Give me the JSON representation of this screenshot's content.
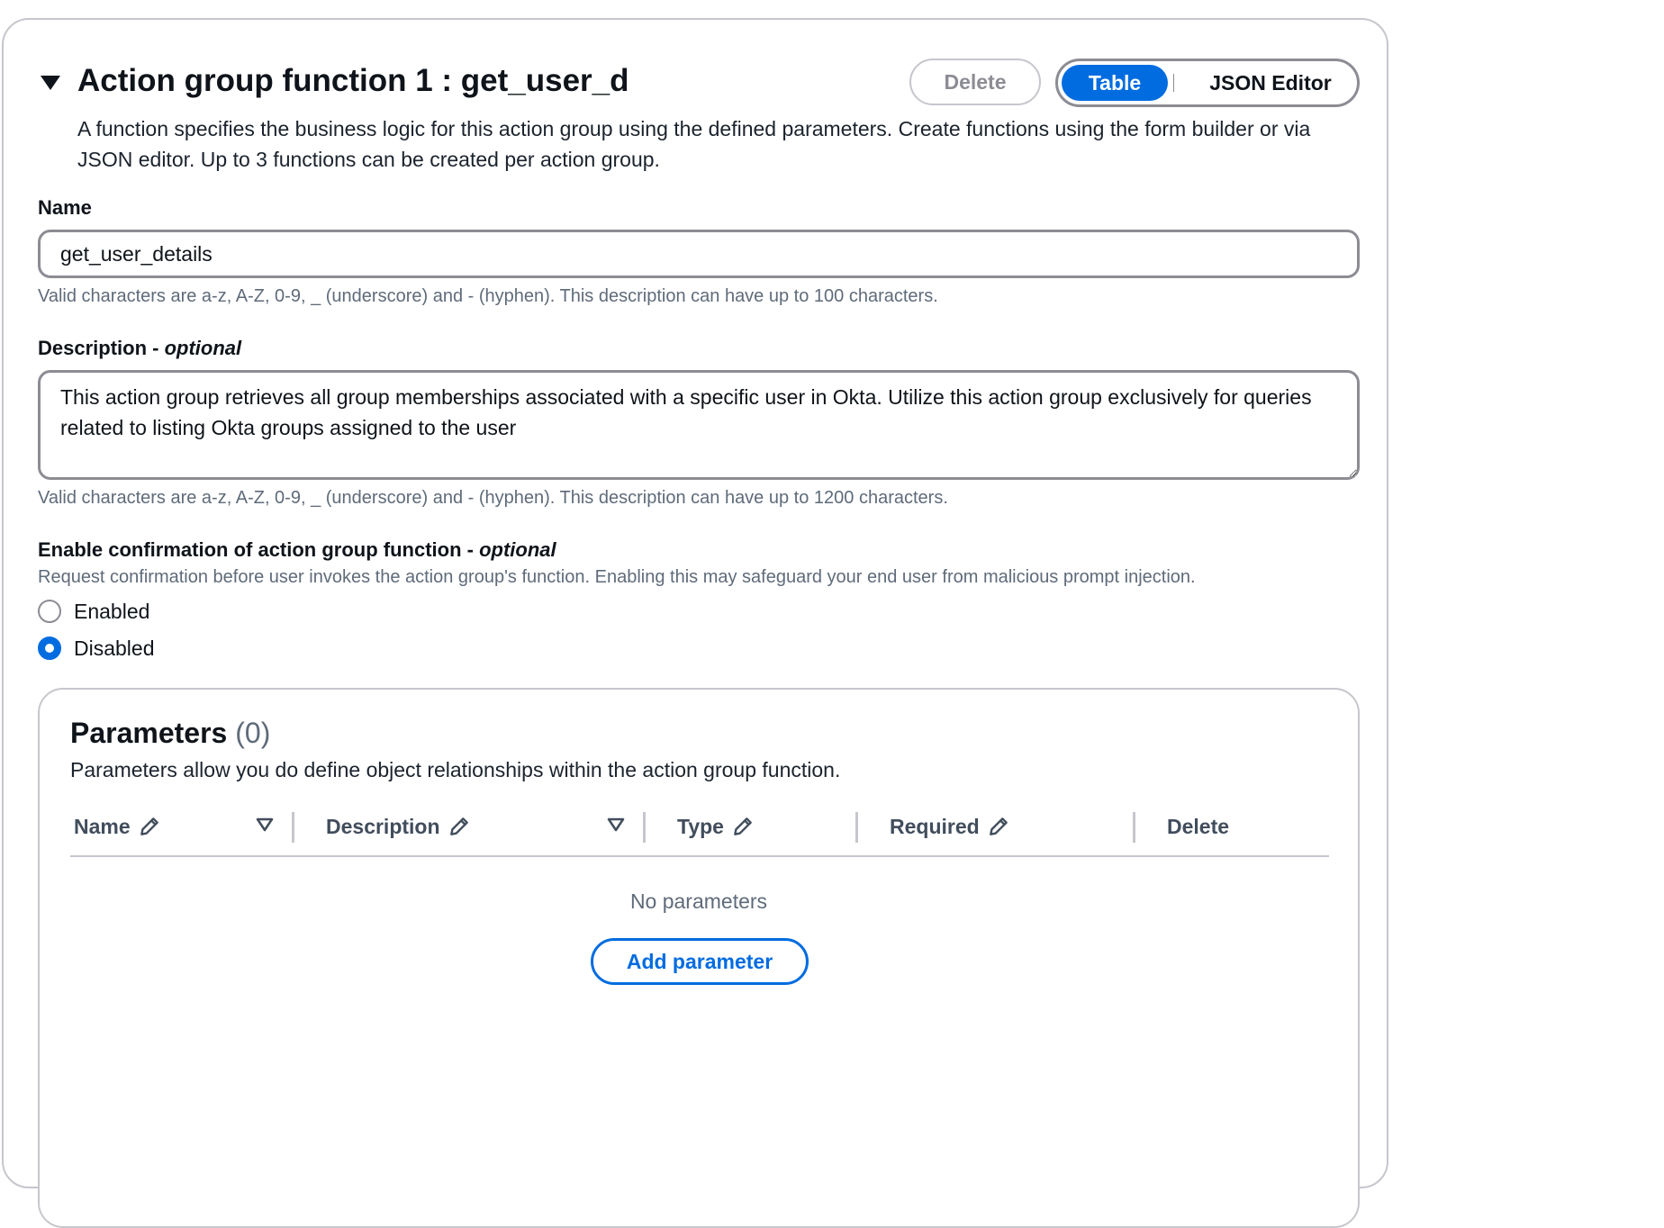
{
  "header": {
    "title": "Action group function 1 : get_user_d",
    "delete_label": "Delete",
    "view_toggle": {
      "table_label": "Table",
      "json_label": "JSON Editor",
      "selected": "Table"
    },
    "description": "A function specifies the business logic for this action group using the defined parameters. Create functions using the form builder or via JSON editor. Up to 3 functions can be created per action group."
  },
  "name_field": {
    "label": "Name",
    "value": "get_user_details",
    "help": "Valid characters are a-z, A-Z, 0-9, _ (underscore) and - (hyphen). This description can have up to 100 characters."
  },
  "description_field": {
    "label": "Description - ",
    "label_optional": "optional",
    "value": "This action group retrieves all group memberships associated with a specific user in Okta. Utilize this action group exclusively for queries related to listing Okta groups assigned to the user",
    "help": "Valid characters are a-z, A-Z, 0-9, _ (underscore) and - (hyphen). This description can have up to 1200 characters."
  },
  "confirmation": {
    "label": "Enable confirmation of action group function - ",
    "label_optional": "optional",
    "help": "Request confirmation before user invokes the action group's function. Enabling this may safeguard your end user from malicious prompt injection.",
    "options": [
      {
        "label": "Enabled",
        "checked": false
      },
      {
        "label": "Disabled",
        "checked": true
      }
    ]
  },
  "parameters": {
    "title": "Parameters",
    "count": "(0)",
    "description": "Parameters allow you do define object relationships within the action group function.",
    "columns": [
      "Name",
      "Description",
      "Type",
      "Required",
      "Delete"
    ],
    "empty_text": "No parameters",
    "add_label": "Add parameter"
  },
  "colors": {
    "accent": "#006ce0",
    "border": "#8c8c94",
    "muted": "#5f6b7a"
  }
}
